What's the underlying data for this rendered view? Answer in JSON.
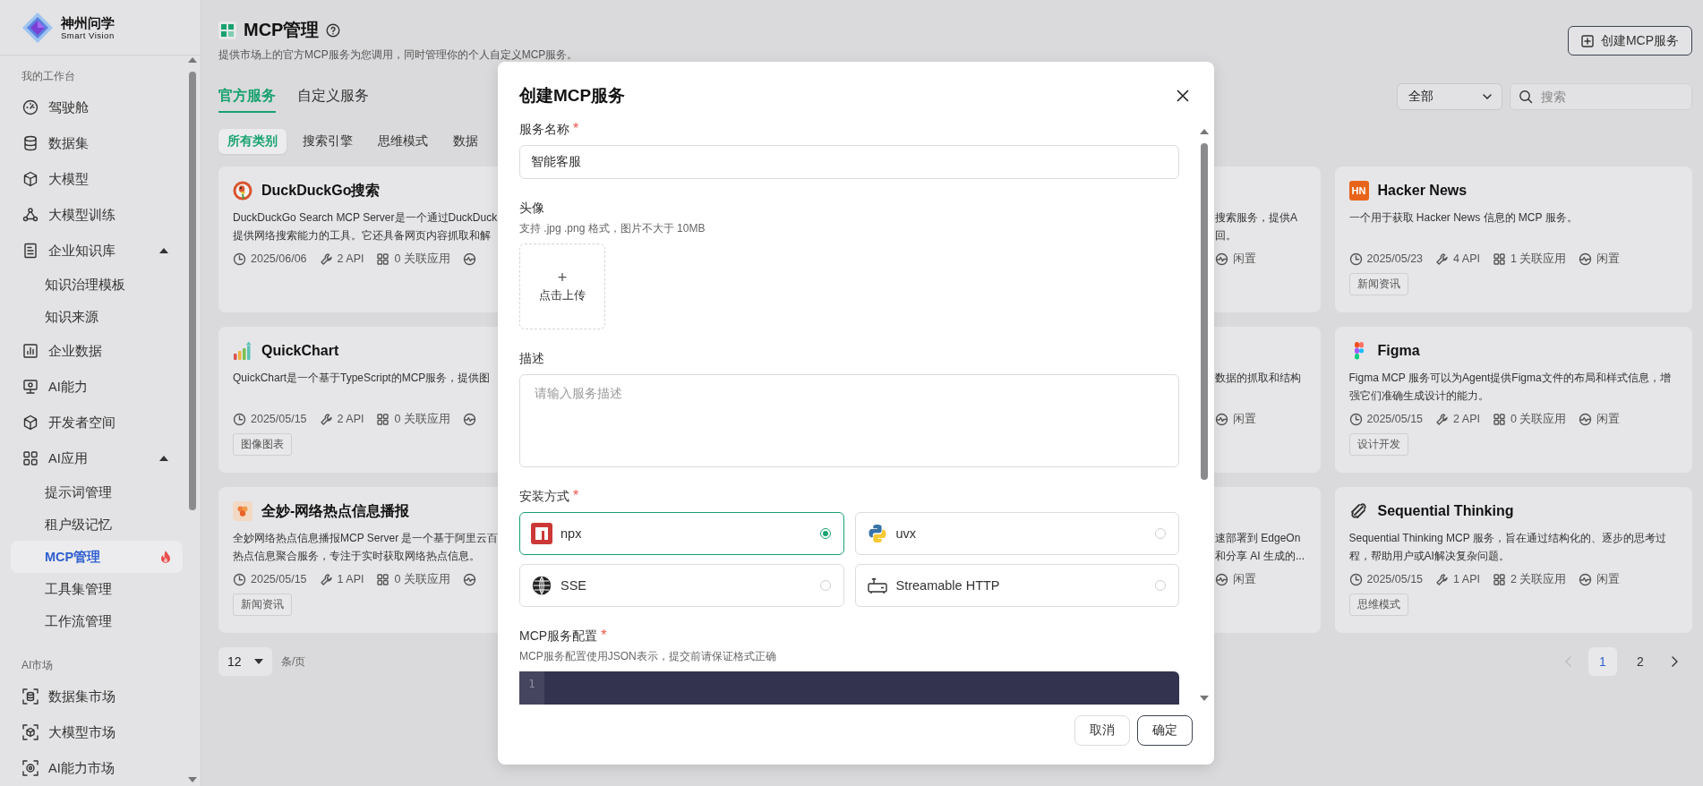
{
  "sidebar": {
    "logo": {
      "name": "神州问学",
      "tagline": "Smart Vision"
    },
    "sections": [
      {
        "title": "我的工作台",
        "items": [
          {
            "label": "驾驶舱",
            "selected": false
          },
          {
            "label": "数据集",
            "selected": false
          },
          {
            "label": "大模型",
            "selected": false
          },
          {
            "label": "大模型训练",
            "selected": false
          },
          {
            "label": "企业知识库",
            "selected": false,
            "expanded": true,
            "children": [
              {
                "label": "知识治理模板",
                "selected": false,
                "hot": false
              },
              {
                "label": "知识来源",
                "selected": false,
                "hot": false
              }
            ]
          },
          {
            "label": "企业数据",
            "selected": false
          },
          {
            "label": "AI能力",
            "selected": false
          },
          {
            "label": "开发者空间",
            "selected": false
          },
          {
            "label": "AI应用",
            "selected": false,
            "expanded": true,
            "children": [
              {
                "label": "提示词管理",
                "selected": false,
                "hot": false
              },
              {
                "label": "租户级记忆",
                "selected": false,
                "hot": false
              },
              {
                "label": "MCP管理",
                "selected": true,
                "hot": true
              },
              {
                "label": "工具集管理",
                "selected": false,
                "hot": false
              },
              {
                "label": "工作流管理",
                "selected": false,
                "hot": false
              }
            ]
          }
        ]
      },
      {
        "title": "AI市场",
        "items": [
          {
            "label": "数据集市场",
            "selected": false
          },
          {
            "label": "大模型市场",
            "selected": false
          },
          {
            "label": "AI能力市场",
            "selected": false
          }
        ]
      }
    ]
  },
  "page": {
    "title": "MCP管理",
    "subtitle": "提供市场上的官方MCP服务为您调用，同时管理你的个人自定义MCP服务。",
    "create_button": "创建MCP服务"
  },
  "tabs": [
    {
      "label": "官方服务",
      "selected": true
    },
    {
      "label": "自定义服务",
      "selected": false
    }
  ],
  "filter": {
    "value": "全部"
  },
  "search": {
    "placeholder": "搜索"
  },
  "categories": [
    {
      "label": "所有类别",
      "selected": true
    },
    {
      "label": "搜索引擎",
      "selected": false
    },
    {
      "label": "思维模式",
      "selected": false
    },
    {
      "label": "数据",
      "selected": false
    }
  ],
  "cards": [
    {
      "kind": "full",
      "title": "DuckDuckGo搜索",
      "description_lines": [
        "DuckDuckGo Search MCP Server是一个通过DuckDuck",
        "提供网络搜索能力的工具。它还具备网页内容抓取和解"
      ],
      "date": "2025/06/06",
      "apis": "2 API",
      "apps": "0 关联应用"
    },
    {
      "kind": "clipped",
      "description_lines": [
        "搜索服务，提供A",
        "回。"
      ],
      "status": "闲置"
    },
    {
      "kind": "full",
      "logo_text": "HN",
      "title": "Hacker News",
      "description_lines": [
        "一个用于获取 Hacker News 信息的 MCP 服务。"
      ],
      "date": "2025/05/23",
      "apis": "4 API",
      "apps": "1 关联应用",
      "status": "闲置",
      "tag": "新闻资讯"
    },
    {
      "kind": "full",
      "title": "QuickChart",
      "description_lines": [
        "QuickChart是一个基于TypeScript的MCP服务，提供图"
      ],
      "date": "2025/05/15",
      "apis": "2 API",
      "apps": "0 关联应用",
      "tag": "图像图表"
    },
    {
      "kind": "clipped",
      "description_lines": [
        "数据的抓取和结构"
      ],
      "status": "闲置"
    },
    {
      "kind": "full",
      "title": "Figma",
      "description_lines": [
        "Figma MCP 服务可以为Agent提供Figma文件的布局和样式信息，增",
        "强它们准确生成设计的能力。"
      ],
      "date": "2025/05/15",
      "apis": "2 API",
      "apps": "0 关联应用",
      "status": "闲置",
      "tag": "设计开发"
    },
    {
      "kind": "full",
      "title": "全妙-网络热点信息播报",
      "description_lines": [
        "全妙网络热点信息播报MCP Server 是一个基于阿里云百",
        "热点信息聚合服务，专注于实时获取网络热点信息。"
      ],
      "date": "2025/05/15",
      "apis": "1 API",
      "apps": "0 关联应用",
      "tag": "新闻资讯"
    },
    {
      "kind": "clipped",
      "description_lines": [
        "速部署到 EdgeOn",
        "和分享 AI 生成的..."
      ],
      "status": "闲置"
    },
    {
      "kind": "full",
      "title": "Sequential Thinking",
      "description_lines": [
        "Sequential Thinking MCP 服务，旨在通过结构化的、逐步的思考过",
        "程，帮助用户或AI解决复杂问题。"
      ],
      "date": "2025/05/15",
      "apis": "1 API",
      "apps": "2 关联应用",
      "status": "闲置",
      "tag": "思维模式"
    }
  ],
  "pagination": {
    "page_size": "12",
    "unit": "条/页",
    "prev_disabled": true,
    "pages": [
      {
        "label": "1",
        "selected": true
      },
      {
        "label": "2",
        "selected": false
      }
    ]
  },
  "modal": {
    "title": "创建MCP服务",
    "fields": [
      {
        "kind": "text",
        "label": "服务名称",
        "required_mark": "*",
        "value": "智能客服"
      },
      {
        "kind": "upload",
        "label": "头像",
        "hint": "支持 .jpg .png 格式，图片不大于 10MB",
        "plus": "+",
        "button_label": "点击上传"
      },
      {
        "kind": "textarea",
        "label": "描述",
        "placeholder": "请输入服务描述"
      },
      {
        "kind": "options",
        "label": "安装方式",
        "required_mark": "*",
        "options": [
          {
            "label": "npx",
            "selected": true
          },
          {
            "label": "uvx",
            "selected": false
          },
          {
            "label": "SSE",
            "selected": false
          },
          {
            "label": "Streamable HTTP",
            "selected": false
          }
        ]
      },
      {
        "kind": "code",
        "label": "MCP服务配置",
        "required_mark": "*",
        "hint": "MCP服务配置使用JSON表示，提交前请保证格式正确",
        "line_numbers": [
          "1"
        ]
      }
    ],
    "buttons": [
      {
        "label": "取消",
        "kind": "secondary"
      },
      {
        "label": "确定",
        "kind": "primary"
      }
    ]
  }
}
